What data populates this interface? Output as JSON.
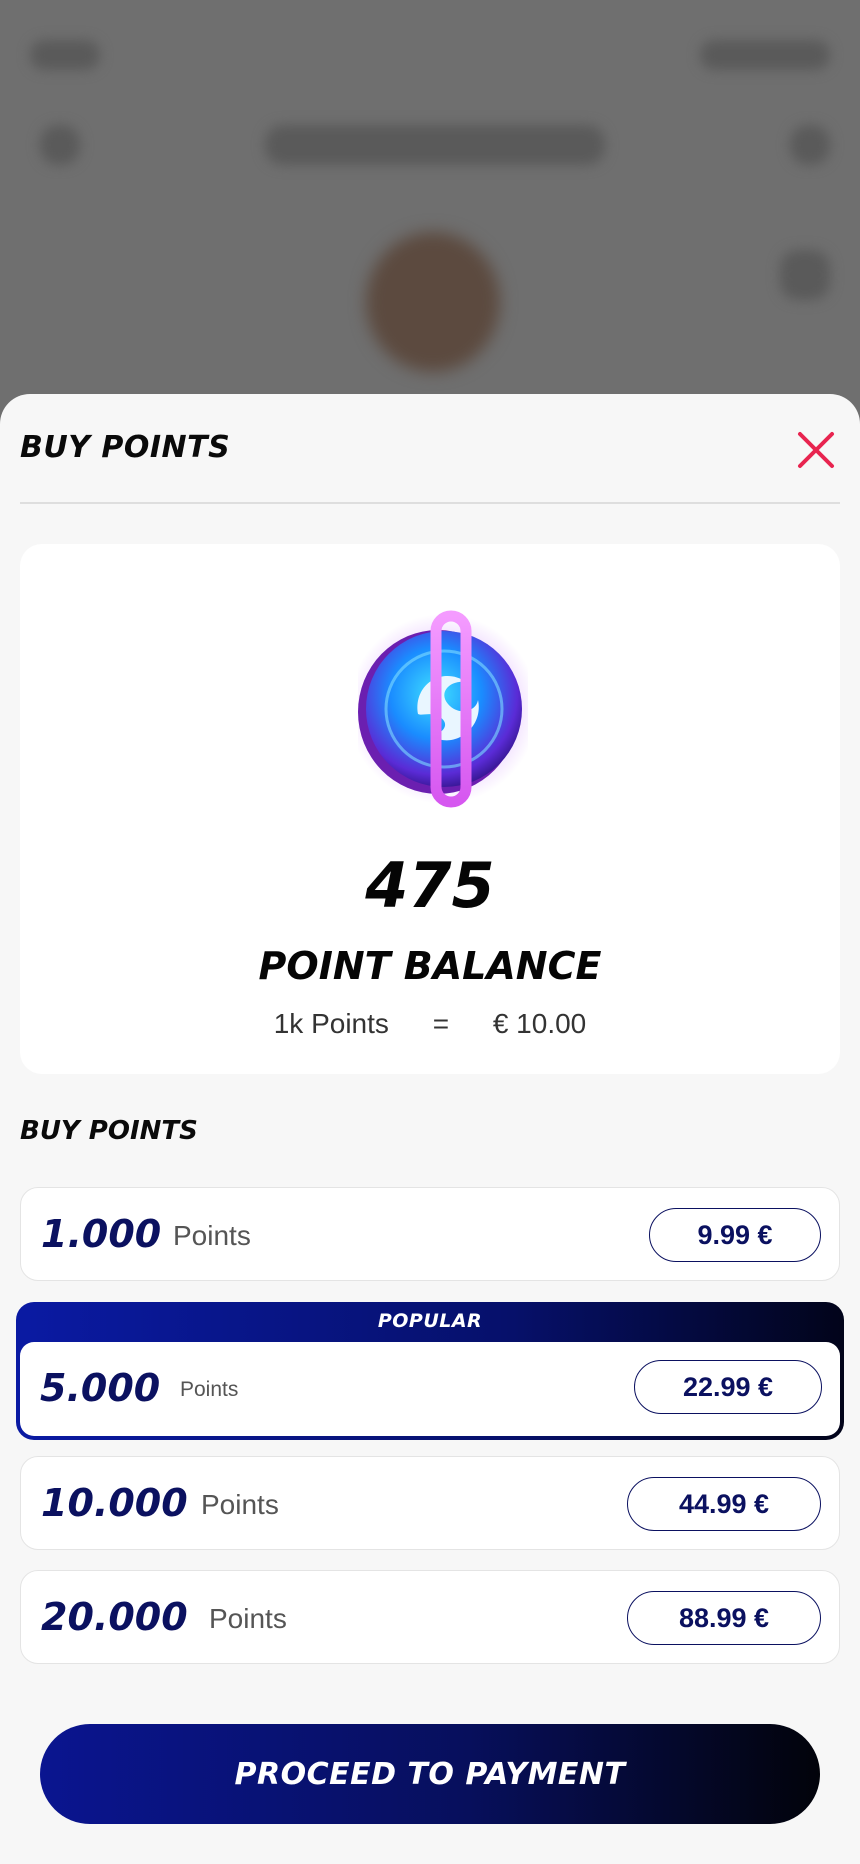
{
  "sheet": {
    "title": "BUY POINTS"
  },
  "balance": {
    "value": "475",
    "label": "POINT BALANCE",
    "rate_points": "1k Points",
    "rate_equals": "=",
    "rate_money": "€ 10.00"
  },
  "packages": {
    "title": "BUY POINTS",
    "popular_tag": "POPULAR",
    "items": [
      {
        "amount": "1.000",
        "unit": "Points",
        "price": "9.99 €"
      },
      {
        "amount": "5.000",
        "unit": "Points",
        "price": "22.99 €"
      },
      {
        "amount": "10.000",
        "unit": "Points",
        "price": "44.99 €"
      },
      {
        "amount": "20.000",
        "unit": "Points",
        "price": "88.99 €"
      }
    ]
  },
  "actions": {
    "proceed_label": "PROCEED TO PAYMENT"
  },
  "colors": {
    "accent_navy": "#0b1160",
    "close_red": "#e8244f",
    "coin_ring": "#e070f0"
  },
  "icons": {
    "close": "close-icon",
    "coin": "points-coin-icon"
  }
}
